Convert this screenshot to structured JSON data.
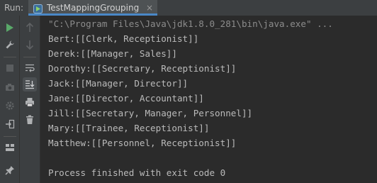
{
  "header": {
    "run_label": "Run:",
    "tab_title": "TestMappingGrouping",
    "tab_close": "×"
  },
  "toolbar": {
    "left": [
      "run-icon",
      "wrench-icon",
      "stop-icon",
      "camera-icon",
      "settings-icon",
      "login-icon",
      "layout-icon",
      "pin-icon"
    ],
    "right": [
      "up-arrow-icon",
      "down-arrow-icon",
      "soft-wrap-icon",
      "scroll-to-end-icon",
      "print-icon",
      "trash-icon"
    ]
  },
  "console": {
    "command": "\"C:\\Program Files\\Java\\jdk1.8.0_281\\bin\\java.exe\" ...",
    "lines": [
      "Bert:[[Clerk, Receptionist]]",
      "Derek:[[Manager, Sales]]",
      "Dorothy:[[Secretary, Receptionist]]",
      "Jack:[[Manager, Director]]",
      "Jane:[[Director, Accountant]]",
      "Jill:[[Secretary, Manager, Personnel]]",
      "Mary:[[Trainee, Receptionist]]",
      "Matthew:[[Personnel, Receptionist]]"
    ],
    "exit_message": "Process finished with exit code 0"
  },
  "colors": {
    "background": "#2b2b2b",
    "panel": "#3c3f41",
    "output_text": "#bbbbbb",
    "command_text": "#8c8c8c",
    "run_green": "#59a869",
    "tab_underline": "#4a88c7"
  }
}
